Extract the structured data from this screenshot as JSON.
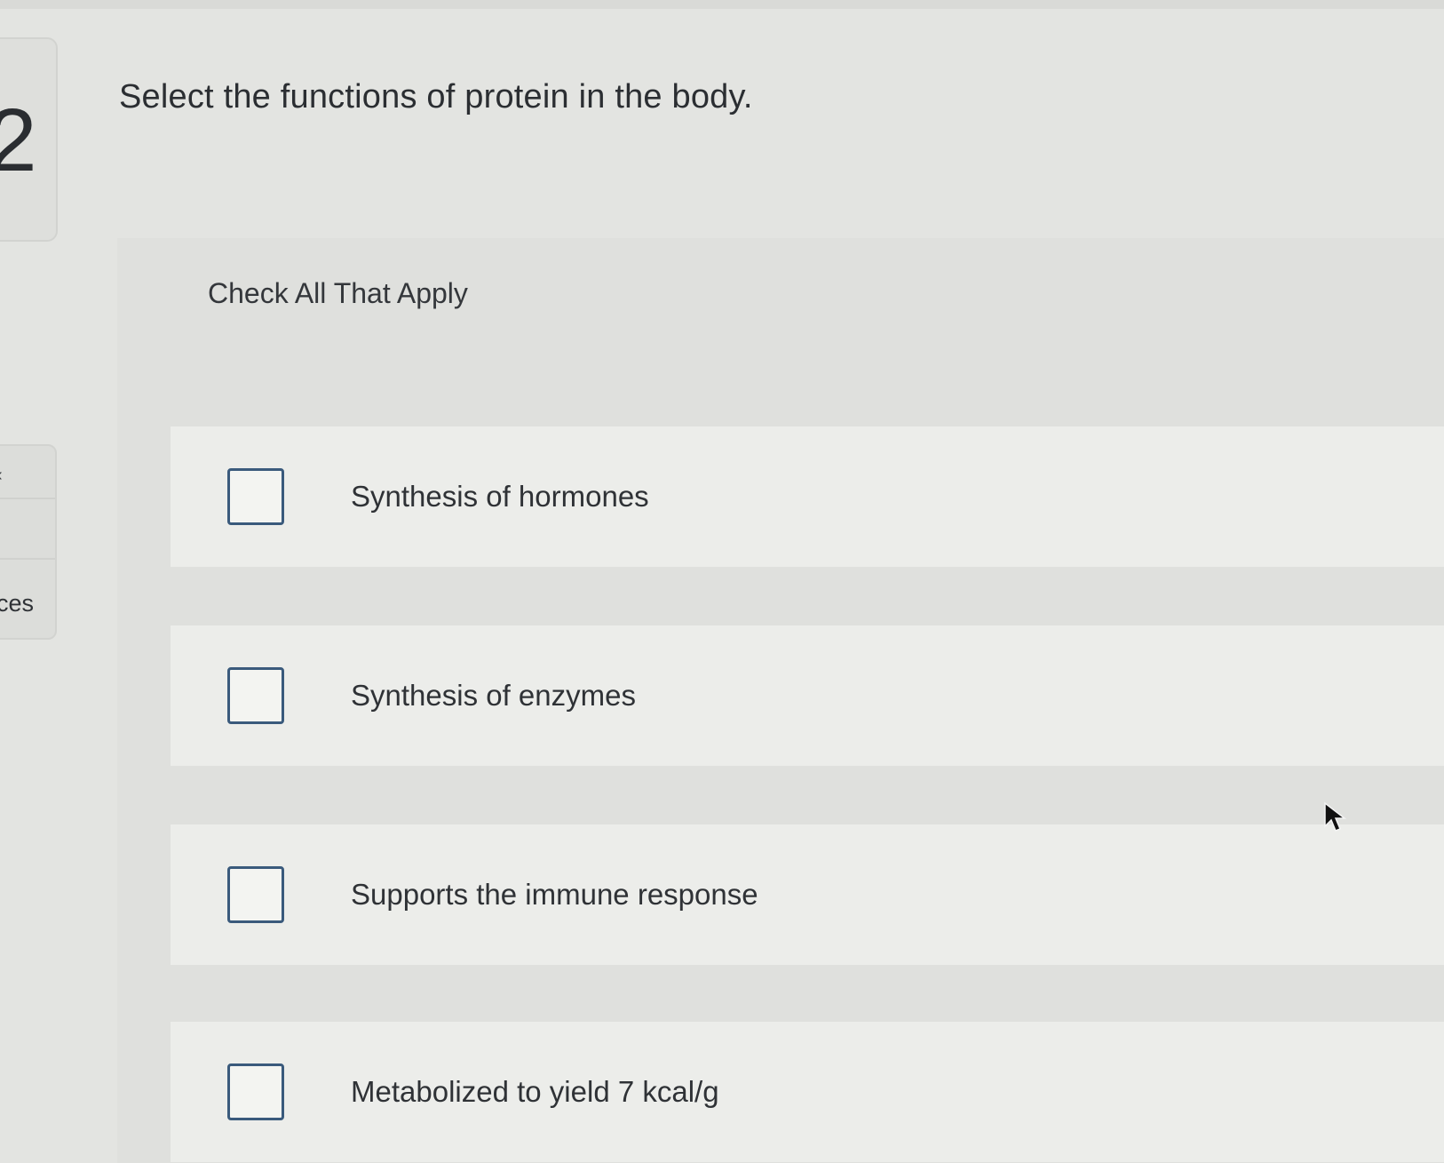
{
  "sidebar": {
    "question_number": "2",
    "nav_glyph": "‹",
    "nav_label": "ces"
  },
  "question": {
    "prompt": "Select the functions of protein in the body.",
    "instruction": "Check All That Apply",
    "options": [
      {
        "label": "Synthesis of hormones",
        "checked": false
      },
      {
        "label": "Synthesis of enzymes",
        "checked": false
      },
      {
        "label": "Supports the immune response",
        "checked": false
      },
      {
        "label": "Metabolized to yield 7 kcal/g",
        "checked": false
      }
    ]
  },
  "colors": {
    "checkbox_border": "#3a5a7c",
    "text": "#2f3236",
    "panel_bg": "#dfe0dd",
    "option_bg": "#ecedea"
  }
}
